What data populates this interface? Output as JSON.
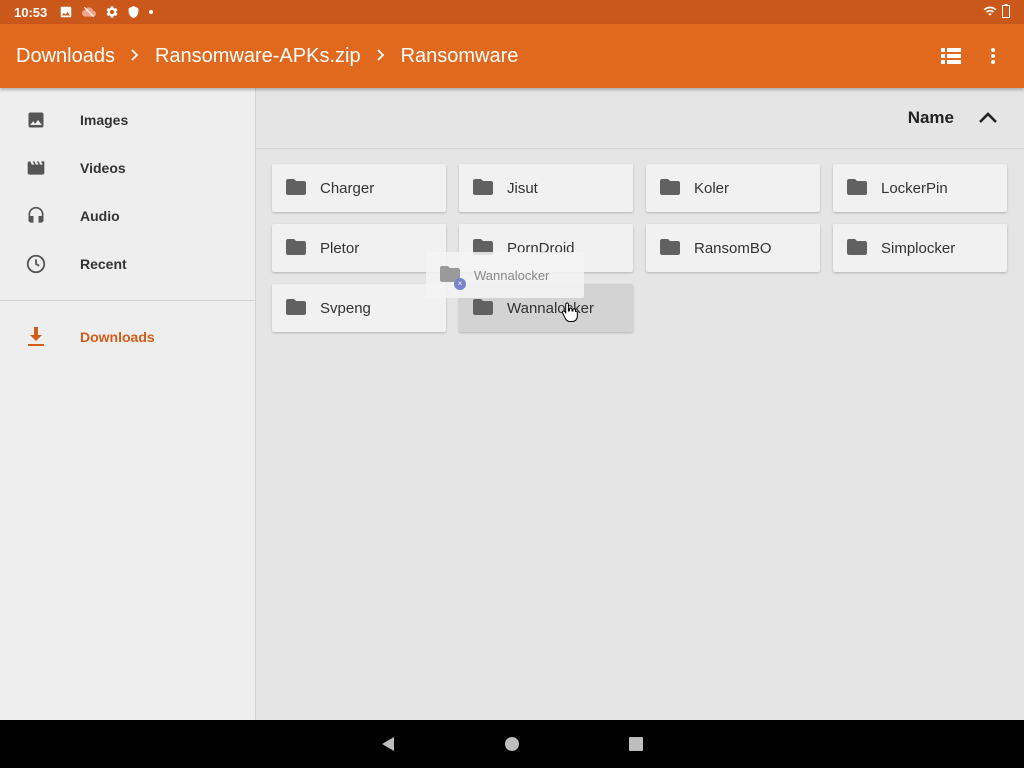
{
  "status_bar": {
    "time": "10:53",
    "icons": [
      "image-icon",
      "cloud-off-icon",
      "settings-icon",
      "shield-icon",
      "dot-icon"
    ],
    "right_icons": [
      "wifi-icon",
      "battery-icon"
    ]
  },
  "app_bar": {
    "breadcrumbs": [
      "Downloads",
      "Ransomware-APKs.zip",
      "Ransomware"
    ],
    "separator": ">",
    "actions": [
      "list-view-icon",
      "more-vert-icon"
    ],
    "color": "#e0691d"
  },
  "sidebar": {
    "items": [
      {
        "label": "Images",
        "icon": "image-icon"
      },
      {
        "label": "Videos",
        "icon": "movie-icon"
      },
      {
        "label": "Audio",
        "icon": "headphones-icon"
      },
      {
        "label": "Recent",
        "icon": "clock-icon"
      }
    ],
    "roots": [
      {
        "label": "Downloads",
        "icon": "download-icon",
        "active": true
      }
    ],
    "active_color": "#d35e1c"
  },
  "sort": {
    "label": "Name",
    "direction": "ascending"
  },
  "folders": [
    {
      "name": "Charger"
    },
    {
      "name": "Jisut"
    },
    {
      "name": "Koler"
    },
    {
      "name": "LockerPin"
    },
    {
      "name": "Pletor"
    },
    {
      "name": "PornDroid"
    },
    {
      "name": "RansomBO"
    },
    {
      "name": "Simplocker"
    },
    {
      "name": "Svpeng"
    },
    {
      "name": "Wannalocker",
      "selected": true
    }
  ],
  "drag": {
    "label": "Wannalocker",
    "badge": "×"
  },
  "nav_bar": {
    "buttons": [
      "back-icon",
      "home-icon",
      "recents-icon"
    ]
  }
}
